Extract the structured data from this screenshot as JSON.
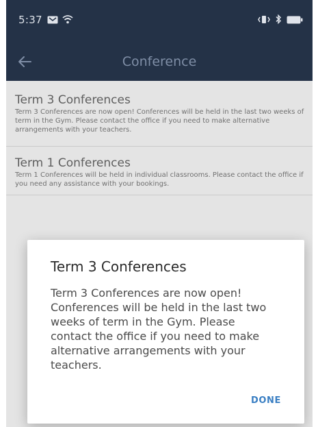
{
  "status_bar": {
    "time": "5:37",
    "icons": [
      "notification-icon",
      "wifi-icon",
      "vibrate-icon",
      "bluetooth-icon",
      "battery-icon"
    ]
  },
  "app_bar": {
    "title": "Conference",
    "back_icon": "arrow-left-icon"
  },
  "conferences": [
    {
      "title": "Term 3 Conferences",
      "body": "Term 3 Conferences are now open! Conferences will be held in the last two weeks of term in the Gym. Please contact the office if you need to make alternative arrangements with your teachers."
    },
    {
      "title": "Term 1 Conferences",
      "body": "Term 1 Conferences will be held in individual classrooms. Please contact the office if you need any assistance with your bookings."
    }
  ],
  "dialog": {
    "title": "Term 3 Conferences",
    "message": "Term 3 Conferences are now open! Conferences will be held in the last two weeks of term in the Gym. Please contact the office if you need to make alternative arrangements with your teachers.",
    "done_label": "DONE"
  },
  "colors": {
    "app_bar": "#243247",
    "accent": "#3a7fc3",
    "scrim_background": "#e4e4e4"
  }
}
